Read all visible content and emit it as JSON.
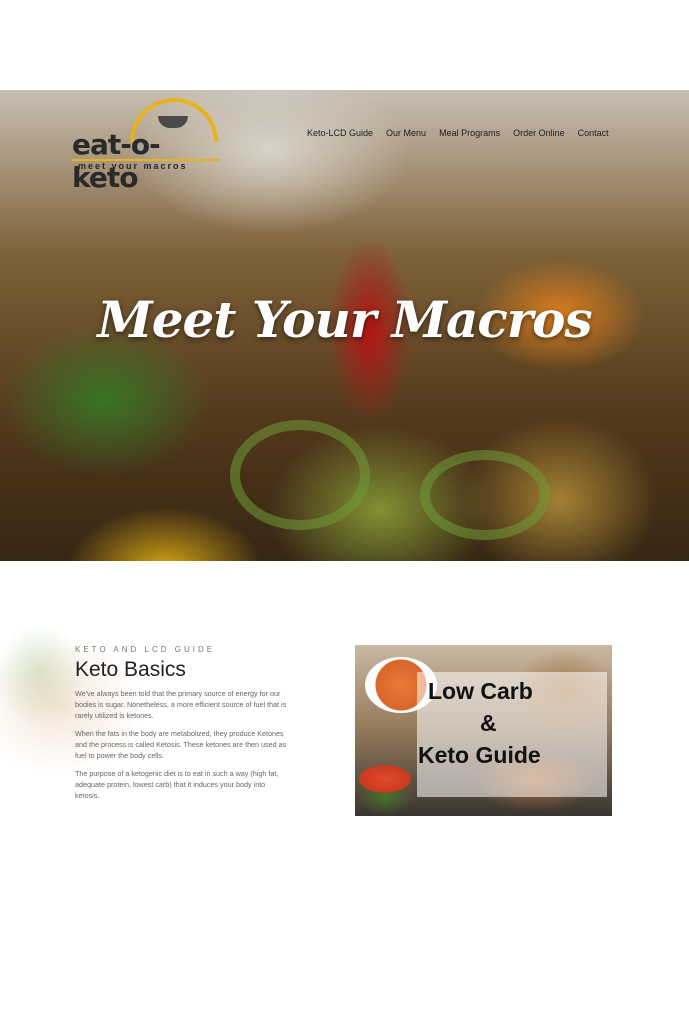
{
  "brand": {
    "logo_text": "eat-o-keto",
    "tagline": "meet your macros"
  },
  "nav": {
    "items": [
      "Keto-LCD Guide",
      "Our Menu",
      "Meal Programs",
      "Order Online",
      "Contact"
    ]
  },
  "hero": {
    "title": "Meet Your Macros"
  },
  "section": {
    "eyebrow": "KETO AND LCD GUIDE",
    "heading": "Keto Basics",
    "paragraphs": [
      "We've always been told that the primary source of energy for our bodies is sugar. Nonetheless, a more efficient source of fuel that is rarely utilized is ketones.",
      "When the fats in the body are metabolized, they produce Ketones and the process is called Ketosis. These ketones are then used as fuel to power the body cells.",
      "The purpose of a ketogenic diet is to eat in such a way (high fat, adequate protein, lowest carb) that it induces your body into ketosis."
    ]
  },
  "guide_image": {
    "line1": "Low Carb",
    "line2": "&",
    "line3": "Keto Guide"
  },
  "colors": {
    "accent": "#e7b21a",
    "text": "#222222"
  }
}
